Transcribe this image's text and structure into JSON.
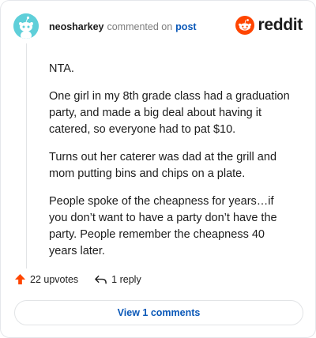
{
  "header": {
    "username": "neosharkey",
    "action": "commented on",
    "target": "post",
    "brand": "reddit",
    "brand_color": "#ff4500"
  },
  "comment": {
    "paragraphs": [
      "NTA.",
      "One girl in my 8th grade class had a graduation party, and made a big deal about having it catered, so everyone had to pat $10.",
      "Turns out her caterer was dad at the grill and mom putting bins and chips on a plate.",
      "People spoke of the cheapness for years…if you don’t want to have a party don’t have the party. People remember the cheapness 40 years later."
    ]
  },
  "footer": {
    "upvotes": "22 upvotes",
    "replies": "1 reply",
    "upvote_icon": "upvote-arrow-icon",
    "reply_icon": "reply-arrow-icon"
  },
  "view_comments": "View 1 comments",
  "colors": {
    "accent": "#0a58b8",
    "upvote": "#ff4500",
    "avatar": "#5fcfd9"
  }
}
